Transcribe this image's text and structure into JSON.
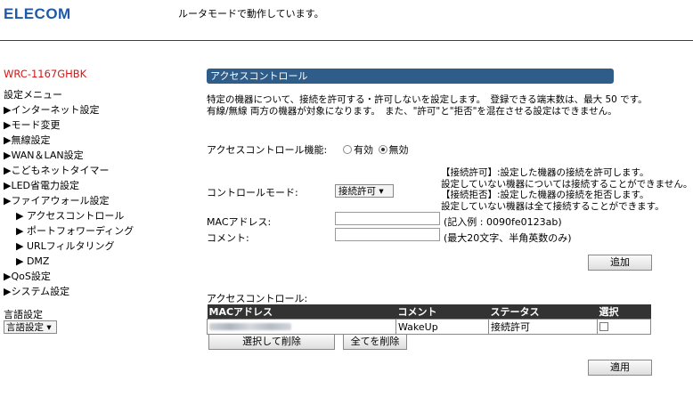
{
  "header": {
    "logo": "ELECOM",
    "status": "ルータモードで動作しています。"
  },
  "sidebar": {
    "model": "WRC-1167GHBK",
    "menu_title": "設定メニュー",
    "items": [
      "▶インターネット設定",
      "▶モード変更",
      "▶無線設定",
      "▶WAN＆LAN設定",
      "▶こどもネットタイマー",
      "▶LED省電力設定",
      "▶ファイアウォール設定"
    ],
    "subitems": [
      "▶ アクセスコントロール",
      "▶ ポートフォワーディング",
      "▶ URLフィルタリング",
      "▶ DMZ"
    ],
    "items2": [
      "▶QoS設定",
      "▶システム設定"
    ],
    "lang_label": "言語設定",
    "lang_select": "言語設定 ▾"
  },
  "main": {
    "title": "アクセスコントロール",
    "desc_line1": "特定の機器について、接続を許可する・許可しないを設定します。　登録できる端末数は、最大 50 です。",
    "desc_line2": "有線/無線 両方の機器が対象になります。　また、\"許可\"と\"拒否\"を混在させる設定はできません。",
    "function_label": "アクセスコントロール機能:",
    "radio_enable": "有効",
    "radio_disable": "無効",
    "mode_label": "コントロールモード:",
    "mode_value": "接続許可 ▾",
    "notes": [
      "【接続許可】:設定した機器の接続を許可します。",
      "設定していない機器については接続することができません。",
      "【接続拒否】:設定した機器の接続を拒否します。",
      "設定していない機器は全て接続することができます。"
    ],
    "mac_label": "MACアドレス:",
    "mac_hint": "(記入例 : 0090fe0123ab)",
    "mac_value": "",
    "comment_label": "コメント:",
    "comment_hint": "(最大20文字、半角英数のみ)",
    "comment_value": "",
    "add_button": "追加",
    "table_title": "アクセスコントロール:",
    "columns": [
      "MACアドレス",
      "コメント",
      "ステータス",
      "選択"
    ],
    "rows": [
      {
        "comment": "WakeUp",
        "status": "接続許可"
      }
    ],
    "delete_selected": "選択して削除",
    "delete_all": "全てを削除",
    "apply_button": "適用"
  }
}
